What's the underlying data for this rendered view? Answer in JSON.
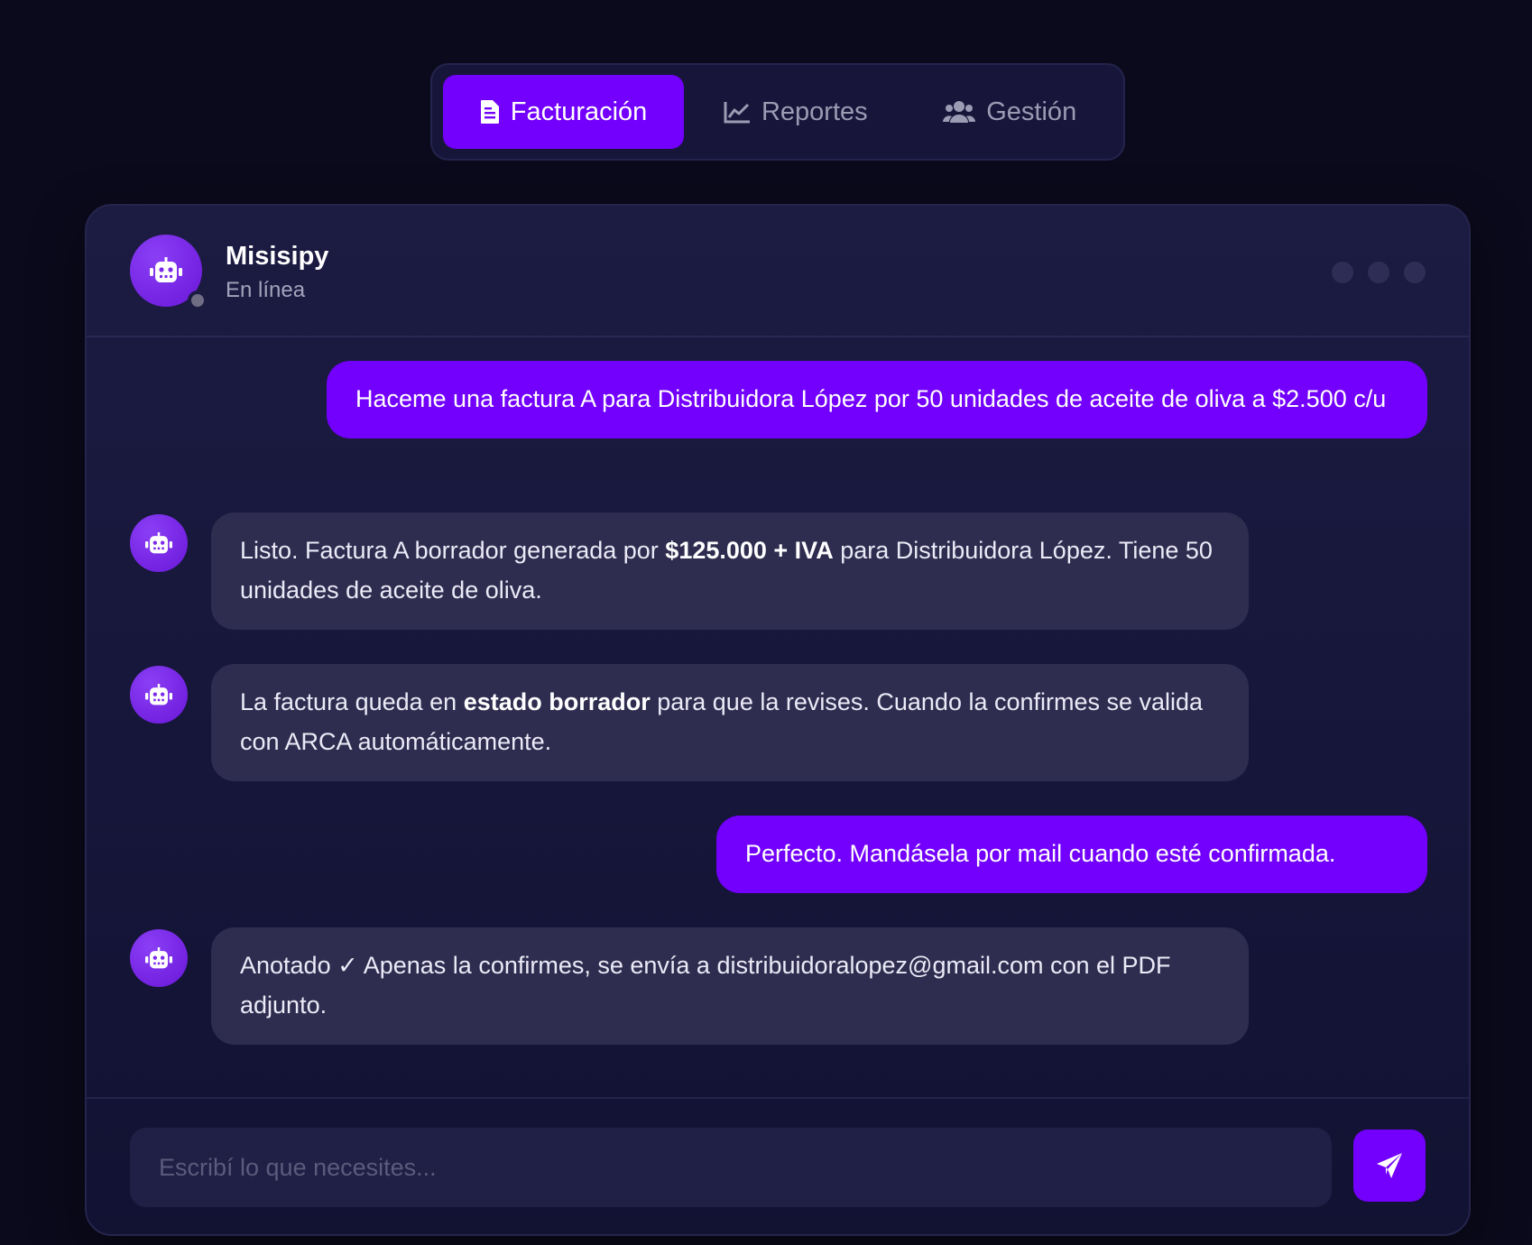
{
  "tabs": [
    {
      "label": "Facturación",
      "icon": "invoice-icon",
      "active": true
    },
    {
      "label": "Reportes",
      "icon": "line-chart-icon",
      "active": false
    },
    {
      "label": "Gestión",
      "icon": "users-icon",
      "active": false
    }
  ],
  "chat": {
    "bot_name": "Misisipy",
    "bot_status": "En línea",
    "bot_avatar_icon": "robot-icon",
    "menu_icon": "three-dots-icon"
  },
  "messages": [
    {
      "from": "user",
      "text": "Haceme una factura A para Distribuidora López por 50 unidades de aceite de oliva a $2.500 c/u"
    },
    {
      "from": "bot",
      "pre": "Listo. Factura A borrador generada por ",
      "bold": "$125.000 + IVA",
      "post": " para Distribuidora López. Tiene 50 unidades de aceite de oliva."
    },
    {
      "from": "bot",
      "pre": "La factura queda en ",
      "bold": "estado borrador",
      "post": " para que la revises. Cuando la confirmes se valida con ARCA automáticamente."
    },
    {
      "from": "user",
      "text": "Perfecto. Mandásela por mail cuando esté confirmada."
    },
    {
      "from": "bot",
      "text": "Anotado ✓ Apenas la confirmes, se envía a distribuidoralopez@gmail.com con el PDF adjunto."
    }
  ],
  "composer": {
    "placeholder": "Escribí lo que necesites...",
    "value": "",
    "send_icon": "send-icon"
  },
  "colors": {
    "accent": "#7200fc",
    "background": "#0b0a1c",
    "bot_bubble": "#2e2d4f"
  }
}
